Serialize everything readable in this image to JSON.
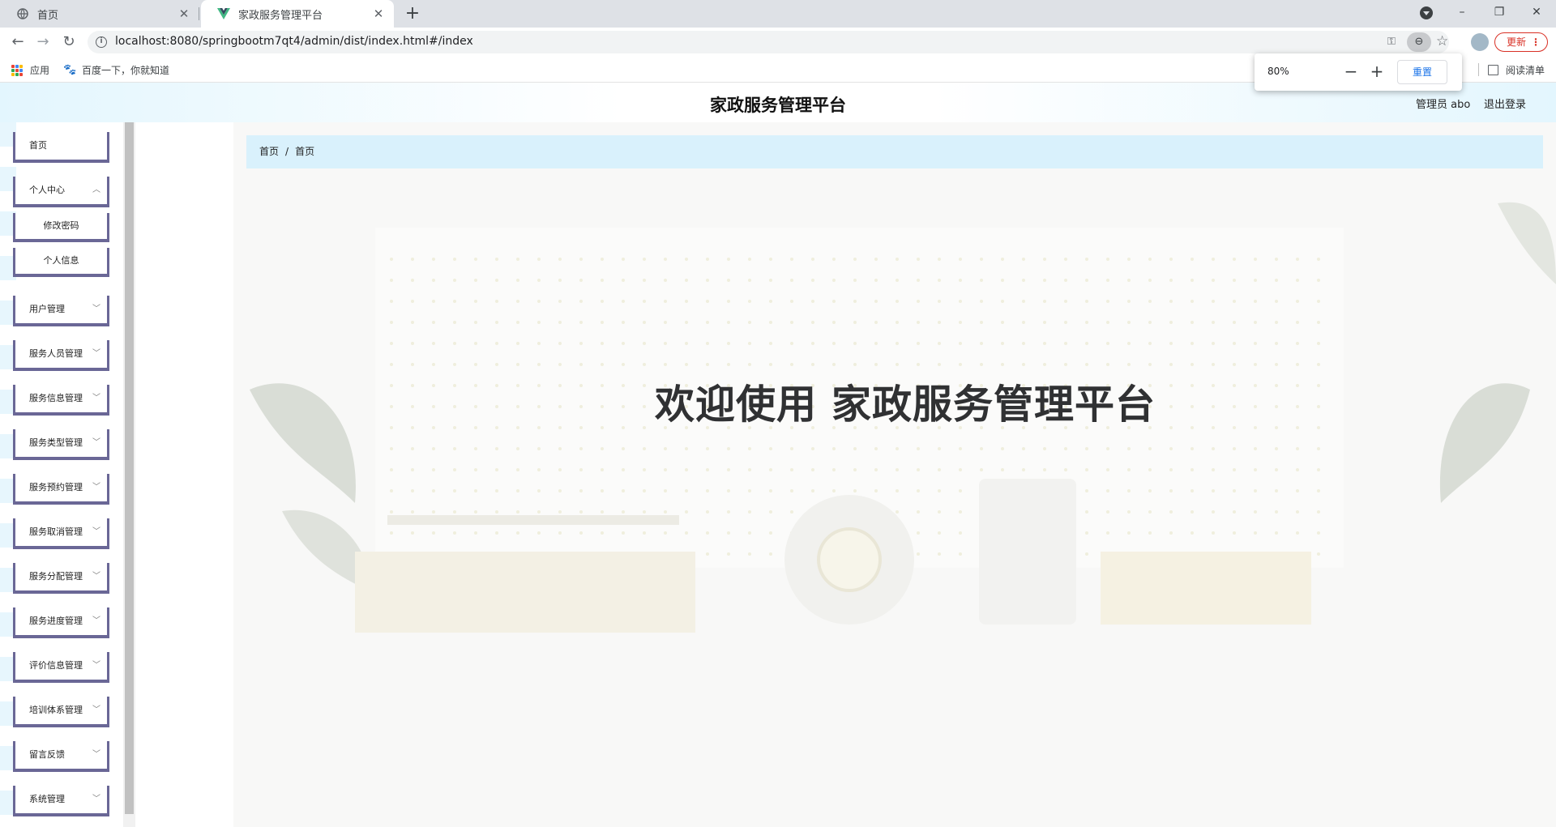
{
  "browser": {
    "tabs": [
      {
        "title": "首页"
      },
      {
        "title": "家政服务管理平台"
      }
    ],
    "url": "localhost:8080/springbootm7qt4/admin/dist/index.html#/index",
    "update_label": "更新",
    "bookmarks": [
      {
        "label": "应用"
      },
      {
        "label": "百度一下，你就知道"
      }
    ],
    "reading_list": "阅读清单",
    "zoom": {
      "level": "80%",
      "reset_label": "重置"
    }
  },
  "app": {
    "title": "家政服务管理平台",
    "user": "管理员 abo",
    "logout": "退出登录",
    "welcome": "欢迎使用 家政服务管理平台"
  },
  "breadcrumb": [
    "首页",
    "首页"
  ],
  "sidebar": {
    "items": [
      {
        "label": "首页"
      },
      {
        "label": "个人中心"
      },
      {
        "label": "修改密码"
      },
      {
        "label": "个人信息"
      },
      {
        "label": "用户管理"
      },
      {
        "label": "服务人员管理"
      },
      {
        "label": "服务信息管理"
      },
      {
        "label": "服务类型管理"
      },
      {
        "label": "服务预约管理"
      },
      {
        "label": "服务取消管理"
      },
      {
        "label": "服务分配管理"
      },
      {
        "label": "服务进度管理"
      },
      {
        "label": "评价信息管理"
      },
      {
        "label": "培训体系管理"
      },
      {
        "label": "留言反馈"
      },
      {
        "label": "系统管理"
      }
    ]
  },
  "colors": {
    "menu_border": "#6a6796",
    "breadcrumb_bg": "#d9f1fc",
    "header_gradient": "#e3f6fe",
    "update_red": "#d93025",
    "link_blue": "#1a73e8"
  }
}
